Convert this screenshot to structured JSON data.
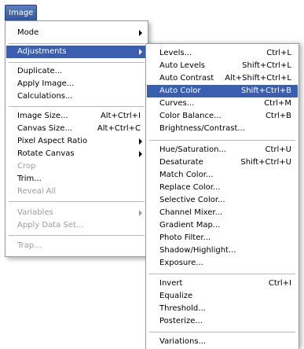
{
  "menubar": {
    "title": "Image"
  },
  "main_menu": {
    "items": [
      {
        "label": "Mode",
        "submenu": true
      },
      {
        "label": "Adjustments",
        "submenu": true,
        "highlighted": true
      },
      {
        "label": "Duplicate..."
      },
      {
        "label": "Apply Image..."
      },
      {
        "label": "Calculations..."
      },
      {
        "label": "Image Size...",
        "shortcut": "Alt+Ctrl+I"
      },
      {
        "label": "Canvas Size...",
        "shortcut": "Alt+Ctrl+C"
      },
      {
        "label": "Pixel Aspect Ratio",
        "submenu": true
      },
      {
        "label": "Rotate Canvas",
        "submenu": true
      },
      {
        "label": "Crop",
        "disabled": true
      },
      {
        "label": "Trim..."
      },
      {
        "label": "Reveal All",
        "disabled": true
      },
      {
        "label": "Variables",
        "submenu": true,
        "disabled": true
      },
      {
        "label": "Apply Data Set...",
        "disabled": true
      },
      {
        "label": "Trap...",
        "disabled": true
      }
    ]
  },
  "adjustments_menu": {
    "items": [
      {
        "label": "Levels...",
        "shortcut": "Ctrl+L"
      },
      {
        "label": "Auto Levels",
        "shortcut": "Shift+Ctrl+L"
      },
      {
        "label": "Auto Contrast",
        "shortcut": "Alt+Shift+Ctrl+L"
      },
      {
        "label": "Auto Color",
        "shortcut": "Shift+Ctrl+B",
        "highlighted": true
      },
      {
        "label": "Curves...",
        "shortcut": "Ctrl+M"
      },
      {
        "label": "Color Balance...",
        "shortcut": "Ctrl+B"
      },
      {
        "label": "Brightness/Contrast..."
      },
      {
        "label": "Hue/Saturation...",
        "shortcut": "Ctrl+U"
      },
      {
        "label": "Desaturate",
        "shortcut": "Shift+Ctrl+U"
      },
      {
        "label": "Match Color..."
      },
      {
        "label": "Replace Color..."
      },
      {
        "label": "Selective Color..."
      },
      {
        "label": "Channel Mixer..."
      },
      {
        "label": "Gradient Map..."
      },
      {
        "label": "Photo Filter..."
      },
      {
        "label": "Shadow/Highlight..."
      },
      {
        "label": "Exposure..."
      },
      {
        "label": "Invert",
        "shortcut": "Ctrl+I"
      },
      {
        "label": "Equalize"
      },
      {
        "label": "Threshold..."
      },
      {
        "label": "Posterize..."
      },
      {
        "label": "Variations..."
      }
    ]
  },
  "colors": {
    "highlight": "#3a5fb0",
    "disabled_text": "#9c9c9c"
  }
}
